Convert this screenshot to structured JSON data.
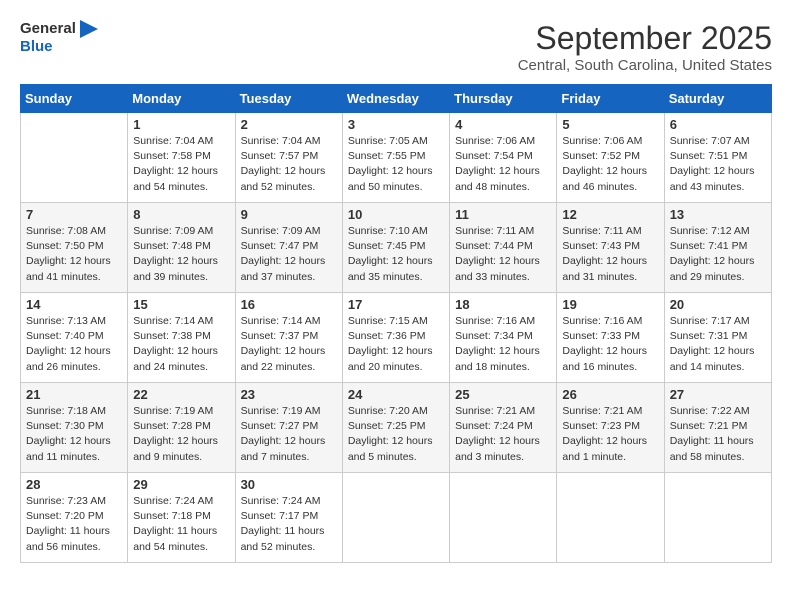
{
  "logo": {
    "line1": "General",
    "line2": "Blue"
  },
  "title": "September 2025",
  "subtitle": "Central, South Carolina, United States",
  "days_of_week": [
    "Sunday",
    "Monday",
    "Tuesday",
    "Wednesday",
    "Thursday",
    "Friday",
    "Saturday"
  ],
  "weeks": [
    [
      {
        "day": "",
        "info": ""
      },
      {
        "day": "1",
        "info": "Sunrise: 7:04 AM\nSunset: 7:58 PM\nDaylight: 12 hours\nand 54 minutes."
      },
      {
        "day": "2",
        "info": "Sunrise: 7:04 AM\nSunset: 7:57 PM\nDaylight: 12 hours\nand 52 minutes."
      },
      {
        "day": "3",
        "info": "Sunrise: 7:05 AM\nSunset: 7:55 PM\nDaylight: 12 hours\nand 50 minutes."
      },
      {
        "day": "4",
        "info": "Sunrise: 7:06 AM\nSunset: 7:54 PM\nDaylight: 12 hours\nand 48 minutes."
      },
      {
        "day": "5",
        "info": "Sunrise: 7:06 AM\nSunset: 7:52 PM\nDaylight: 12 hours\nand 46 minutes."
      },
      {
        "day": "6",
        "info": "Sunrise: 7:07 AM\nSunset: 7:51 PM\nDaylight: 12 hours\nand 43 minutes."
      }
    ],
    [
      {
        "day": "7",
        "info": "Sunrise: 7:08 AM\nSunset: 7:50 PM\nDaylight: 12 hours\nand 41 minutes."
      },
      {
        "day": "8",
        "info": "Sunrise: 7:09 AM\nSunset: 7:48 PM\nDaylight: 12 hours\nand 39 minutes."
      },
      {
        "day": "9",
        "info": "Sunrise: 7:09 AM\nSunset: 7:47 PM\nDaylight: 12 hours\nand 37 minutes."
      },
      {
        "day": "10",
        "info": "Sunrise: 7:10 AM\nSunset: 7:45 PM\nDaylight: 12 hours\nand 35 minutes."
      },
      {
        "day": "11",
        "info": "Sunrise: 7:11 AM\nSunset: 7:44 PM\nDaylight: 12 hours\nand 33 minutes."
      },
      {
        "day": "12",
        "info": "Sunrise: 7:11 AM\nSunset: 7:43 PM\nDaylight: 12 hours\nand 31 minutes."
      },
      {
        "day": "13",
        "info": "Sunrise: 7:12 AM\nSunset: 7:41 PM\nDaylight: 12 hours\nand 29 minutes."
      }
    ],
    [
      {
        "day": "14",
        "info": "Sunrise: 7:13 AM\nSunset: 7:40 PM\nDaylight: 12 hours\nand 26 minutes."
      },
      {
        "day": "15",
        "info": "Sunrise: 7:14 AM\nSunset: 7:38 PM\nDaylight: 12 hours\nand 24 minutes."
      },
      {
        "day": "16",
        "info": "Sunrise: 7:14 AM\nSunset: 7:37 PM\nDaylight: 12 hours\nand 22 minutes."
      },
      {
        "day": "17",
        "info": "Sunrise: 7:15 AM\nSunset: 7:36 PM\nDaylight: 12 hours\nand 20 minutes."
      },
      {
        "day": "18",
        "info": "Sunrise: 7:16 AM\nSunset: 7:34 PM\nDaylight: 12 hours\nand 18 minutes."
      },
      {
        "day": "19",
        "info": "Sunrise: 7:16 AM\nSunset: 7:33 PM\nDaylight: 12 hours\nand 16 minutes."
      },
      {
        "day": "20",
        "info": "Sunrise: 7:17 AM\nSunset: 7:31 PM\nDaylight: 12 hours\nand 14 minutes."
      }
    ],
    [
      {
        "day": "21",
        "info": "Sunrise: 7:18 AM\nSunset: 7:30 PM\nDaylight: 12 hours\nand 11 minutes."
      },
      {
        "day": "22",
        "info": "Sunrise: 7:19 AM\nSunset: 7:28 PM\nDaylight: 12 hours\nand 9 minutes."
      },
      {
        "day": "23",
        "info": "Sunrise: 7:19 AM\nSunset: 7:27 PM\nDaylight: 12 hours\nand 7 minutes."
      },
      {
        "day": "24",
        "info": "Sunrise: 7:20 AM\nSunset: 7:25 PM\nDaylight: 12 hours\nand 5 minutes."
      },
      {
        "day": "25",
        "info": "Sunrise: 7:21 AM\nSunset: 7:24 PM\nDaylight: 12 hours\nand 3 minutes."
      },
      {
        "day": "26",
        "info": "Sunrise: 7:21 AM\nSunset: 7:23 PM\nDaylight: 12 hours\nand 1 minute."
      },
      {
        "day": "27",
        "info": "Sunrise: 7:22 AM\nSunset: 7:21 PM\nDaylight: 11 hours\nand 58 minutes."
      }
    ],
    [
      {
        "day": "28",
        "info": "Sunrise: 7:23 AM\nSunset: 7:20 PM\nDaylight: 11 hours\nand 56 minutes."
      },
      {
        "day": "29",
        "info": "Sunrise: 7:24 AM\nSunset: 7:18 PM\nDaylight: 11 hours\nand 54 minutes."
      },
      {
        "day": "30",
        "info": "Sunrise: 7:24 AM\nSunset: 7:17 PM\nDaylight: 11 hours\nand 52 minutes."
      },
      {
        "day": "",
        "info": ""
      },
      {
        "day": "",
        "info": ""
      },
      {
        "day": "",
        "info": ""
      },
      {
        "day": "",
        "info": ""
      }
    ]
  ]
}
